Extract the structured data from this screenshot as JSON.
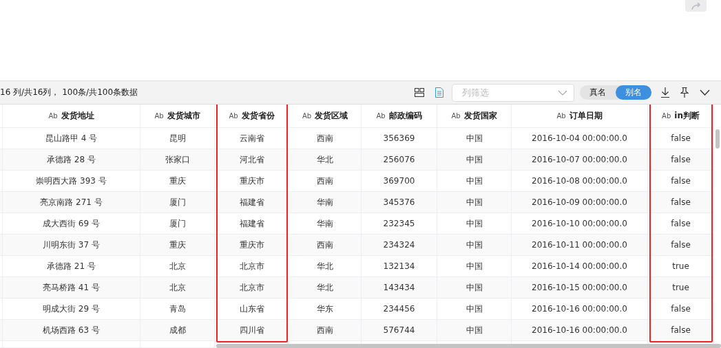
{
  "toolbar": {
    "summary": "16 列/共16列， 100条/共100条数据",
    "column_filter": {
      "placeholder": "列筛选"
    },
    "name_toggle": [
      {
        "label": "真名",
        "selected": false
      },
      {
        "label": "别名",
        "selected": true
      }
    ]
  },
  "table": {
    "columns": [
      {
        "label": "发货地址",
        "type_icon": "Ab",
        "highlighted": false
      },
      {
        "label": "发货城市",
        "type_icon": "Ab",
        "highlighted": false
      },
      {
        "label": "发货省份",
        "type_icon": "Ab",
        "highlighted": true
      },
      {
        "label": "发货区域",
        "type_icon": "Ab",
        "highlighted": false
      },
      {
        "label": "邮政编码",
        "type_icon": "Ab",
        "highlighted": false
      },
      {
        "label": "发货国家",
        "type_icon": "Ab",
        "highlighted": false
      },
      {
        "label": "订单日期",
        "type_icon": "Ab",
        "highlighted": false
      },
      {
        "label": "in判断",
        "type_icon": "Ab",
        "highlighted": true
      }
    ],
    "rows": [
      [
        "昆山路甲 4 号",
        "昆明",
        "云南省",
        "西南",
        "356369",
        "中国",
        "2016-10-04 00:00:00.0",
        "false"
      ],
      [
        "承德路 28 号",
        "张家口",
        "河北省",
        "华北",
        "256076",
        "中国",
        "2016-10-07 00:00:00.0",
        "false"
      ],
      [
        "崇明西大路 393 号",
        "重庆",
        "重庆市",
        "西南",
        "369700",
        "中国",
        "2016-10-08 00:00:00.0",
        "false"
      ],
      [
        "亮京南路 271 号",
        "厦门",
        "福建省",
        "华南",
        "345376",
        "中国",
        "2016-10-09 00:00:00.0",
        "false"
      ],
      [
        "成大西街 69 号",
        "厦门",
        "福建省",
        "华南",
        "232345",
        "中国",
        "2016-10-10 00:00:00.0",
        "false"
      ],
      [
        "川明东街 37 号",
        "重庆",
        "重庆市",
        "西南",
        "234324",
        "中国",
        "2016-10-11 00:00:00.0",
        "false"
      ],
      [
        "承德路 21 号",
        "北京",
        "北京市",
        "华北",
        "132134",
        "中国",
        "2016-10-14 00:00:00.0",
        "true"
      ],
      [
        "亮马桥路 41 号",
        "北京",
        "北京市",
        "华北",
        "143434",
        "中国",
        "2016-10-15 00:00:00.0",
        "true"
      ],
      [
        "明成大街 29 号",
        "青岛",
        "山东省",
        "华东",
        "234456",
        "中国",
        "2016-10-16 00:00:00.0",
        "false"
      ],
      [
        "机场西路 63 号",
        "成都",
        "四川省",
        "西南",
        "576744",
        "中国",
        "2016-10-16 00:00:00.0",
        "false"
      ]
    ]
  }
}
